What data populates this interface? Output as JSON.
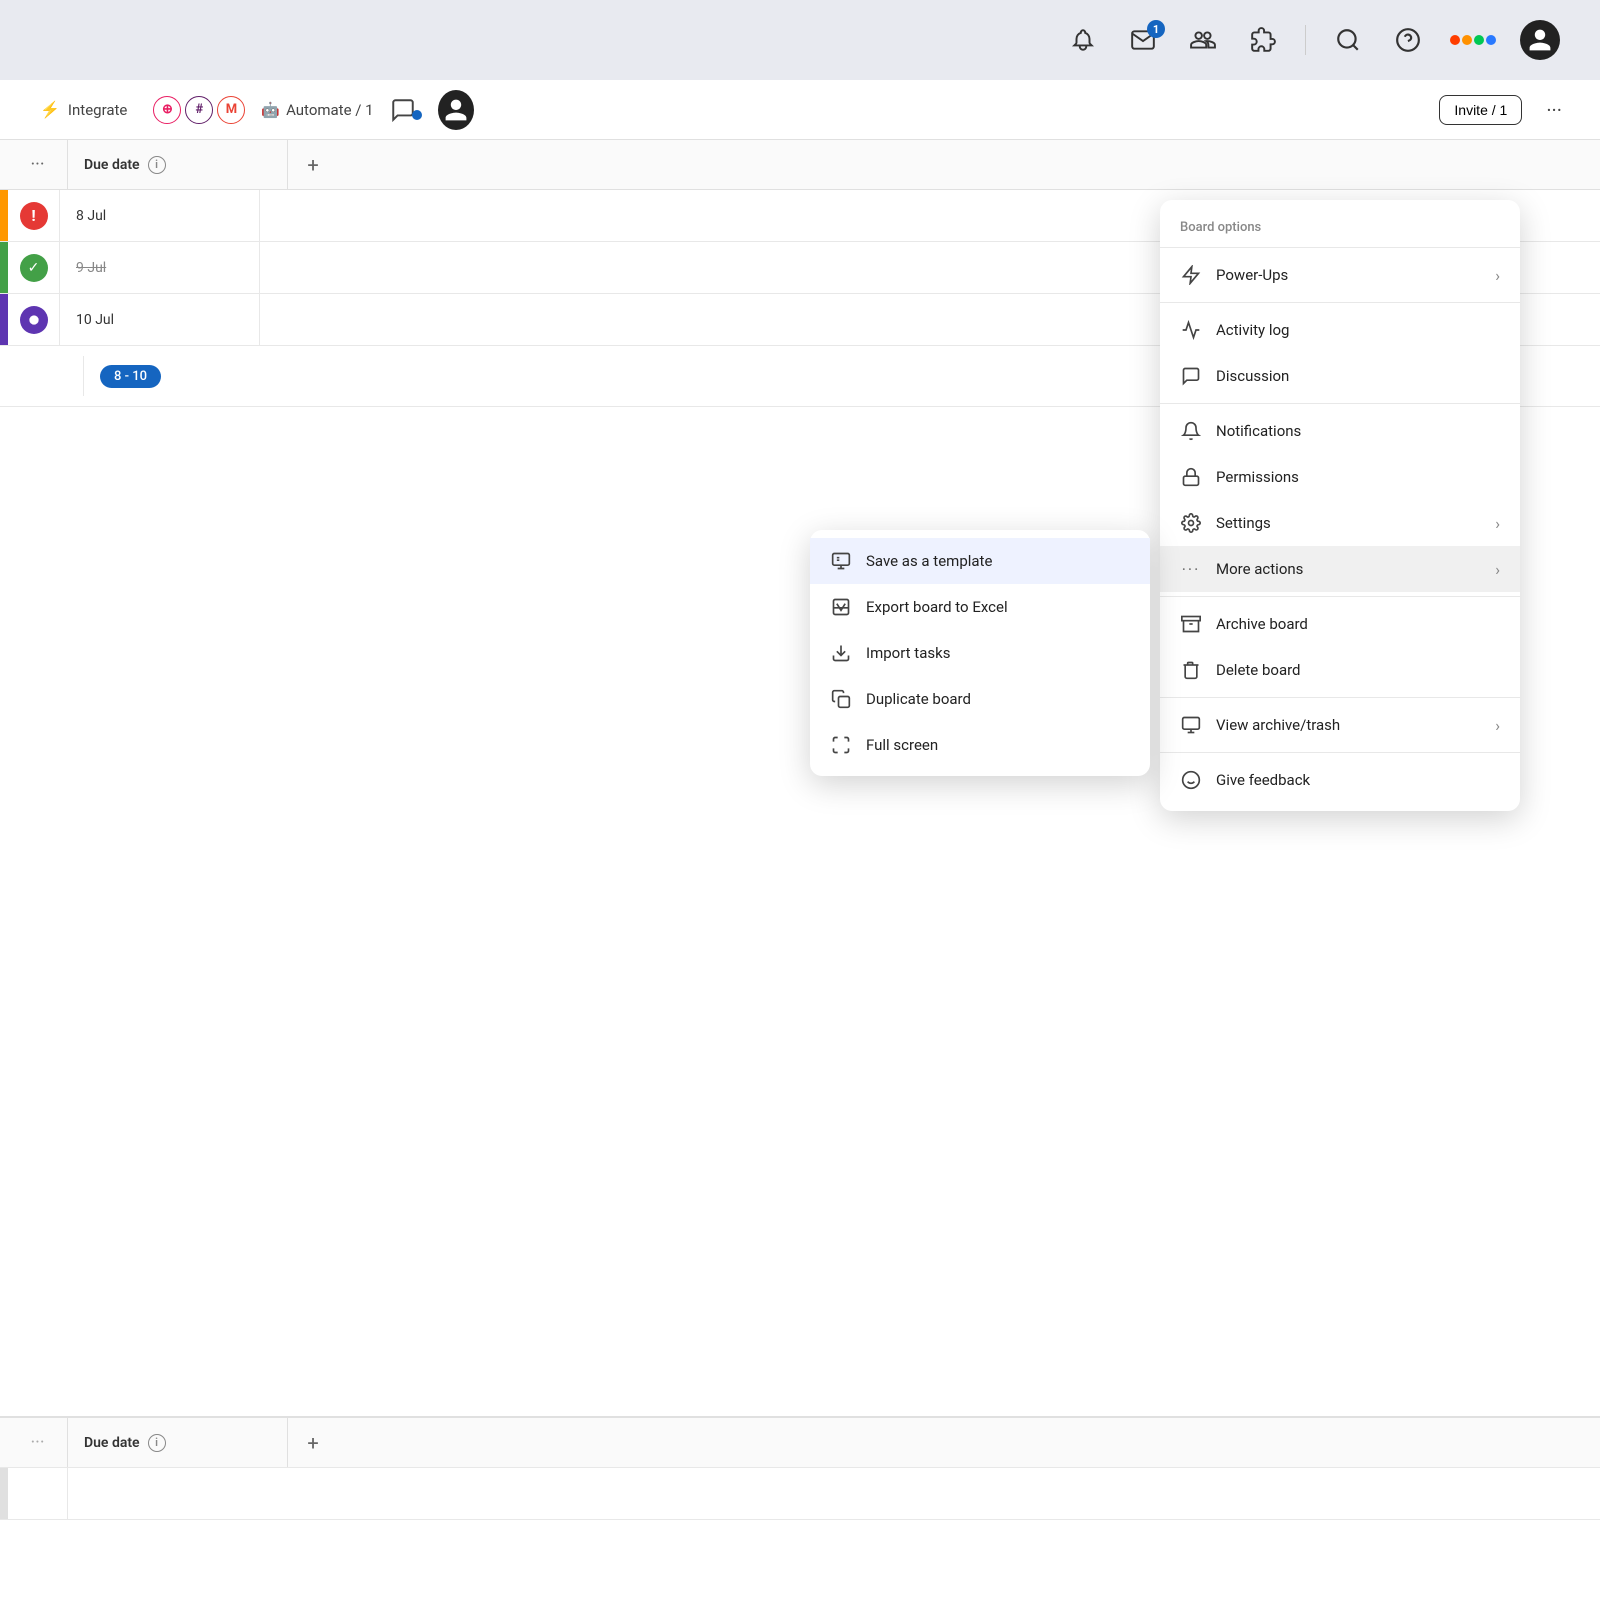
{
  "header": {
    "badge_count": "1",
    "invite_label": "Invite / 1",
    "more_label": "...",
    "automate_label": "Automate / 1"
  },
  "integration_icons": [
    {
      "symbol": "⊕",
      "color": "#e91e63"
    },
    {
      "symbol": "#",
      "color": "#611f69"
    },
    {
      "symbol": "M",
      "color": "#ea4335"
    }
  ],
  "table": {
    "col_due_date": "Due date",
    "col_add": "+",
    "col_dots": "...",
    "rows": [
      {
        "date": "8 Jul",
        "strikethrough": false,
        "status": "red",
        "indicator": "#ff9800"
      },
      {
        "date": "9 Jul",
        "strikethrough": true,
        "status": "green",
        "indicator": "#43a047"
      },
      {
        "date": "10 Jul",
        "strikethrough": false,
        "status": "purple",
        "indicator": "#5e35b1"
      }
    ],
    "range_pill": "8 - 10"
  },
  "board_options": {
    "header": "Board options",
    "items": [
      {
        "key": "power-ups",
        "label": "Power-Ups",
        "has_arrow": true
      },
      {
        "key": "activity-log",
        "label": "Activity log",
        "has_arrow": false
      },
      {
        "key": "discussion",
        "label": "Discussion",
        "has_arrow": false
      },
      {
        "key": "notifications",
        "label": "Notifications",
        "has_arrow": false
      },
      {
        "key": "permissions",
        "label": "Permissions",
        "has_arrow": false
      },
      {
        "key": "settings",
        "label": "Settings",
        "has_arrow": true
      },
      {
        "key": "more-actions",
        "label": "More actions",
        "has_arrow": true,
        "highlighted": true
      },
      {
        "key": "archive-board",
        "label": "Archive board",
        "has_arrow": false
      },
      {
        "key": "delete-board",
        "label": "Delete board",
        "has_arrow": false
      },
      {
        "key": "view-archive",
        "label": "View archive/trash",
        "has_arrow": true
      },
      {
        "key": "give-feedback",
        "label": "Give feedback",
        "has_arrow": false
      }
    ]
  },
  "more_actions_submenu": {
    "items": [
      {
        "key": "save-template",
        "label": "Save as a template",
        "highlighted": true
      },
      {
        "key": "export-excel",
        "label": "Export board to Excel",
        "highlighted": false
      },
      {
        "key": "import-tasks",
        "label": "Import tasks",
        "highlighted": false
      },
      {
        "key": "duplicate-board",
        "label": "Duplicate board",
        "highlighted": false
      },
      {
        "key": "full-screen",
        "label": "Full screen",
        "highlighted": false
      }
    ]
  },
  "second_table": {
    "col_dots": "...",
    "col_due_date": "Due date",
    "col_add": "+"
  }
}
